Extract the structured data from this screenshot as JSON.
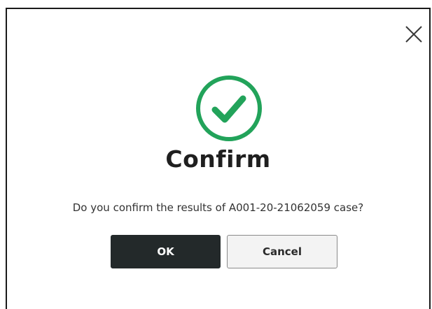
{
  "dialog": {
    "title": "Confirm",
    "message": "Do you confirm the results of A001-20-21062059 case?",
    "ok_label": "OK",
    "cancel_label": "Cancel",
    "icons": {
      "status": "check-circle-icon",
      "close": "close-icon"
    },
    "colors": {
      "success": "#22a35a",
      "primary_button": "#23292a",
      "secondary_button": "#f3f3f3"
    }
  }
}
